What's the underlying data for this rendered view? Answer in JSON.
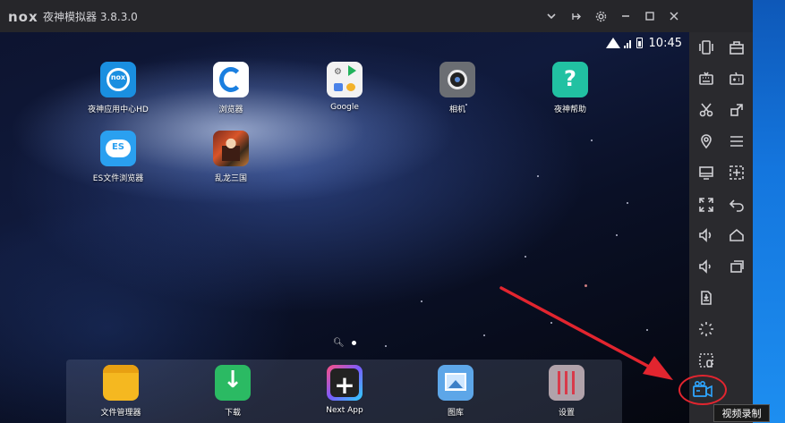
{
  "titlebar": {
    "logo": "nox",
    "app_title": "夜神模拟器 3.8.3.0",
    "buttons": [
      "chevron-down",
      "pin",
      "gear",
      "minimize",
      "maximize",
      "close"
    ]
  },
  "statusbar": {
    "time": "10:45"
  },
  "home_apps": [
    {
      "id": "nox-app-center",
      "label": "夜神应用中心HD",
      "icon": "nox-app-center-icon"
    },
    {
      "id": "browser",
      "label": "浏览器",
      "icon": "browser-icon"
    },
    {
      "id": "google",
      "label": "Google",
      "icon": "google-folder-icon"
    },
    {
      "id": "camera",
      "label": "相机",
      "icon": "camera-icon"
    },
    {
      "id": "nox-help",
      "label": "夜神帮助",
      "icon": "help-icon"
    },
    {
      "id": "es-file",
      "label": "ES文件浏览器",
      "icon": "es-file-explorer-icon"
    },
    {
      "id": "game",
      "label": "乱龙三国",
      "icon": "game-icon"
    }
  ],
  "dock_apps": [
    {
      "id": "file-manager",
      "label": "文件管理器",
      "icon": "folder-icon"
    },
    {
      "id": "download",
      "label": "下载",
      "icon": "download-icon"
    },
    {
      "id": "next-app",
      "label": "Next App",
      "icon": "next-app-icon"
    },
    {
      "id": "gallery",
      "label": "图库",
      "icon": "gallery-icon"
    },
    {
      "id": "settings",
      "label": "设置",
      "icon": "settings-icon"
    }
  ],
  "toolbar": {
    "tools": [
      "shake-icon",
      "toolbox-icon",
      "keyboard-icon",
      "gamepad-icon",
      "scissors-icon",
      "resize-icon",
      "location-icon",
      "menu-icon",
      "screen-icon",
      "add-icon",
      "fullscreen-icon",
      "back-icon",
      "volume-up-icon",
      "home-icon",
      "volume-down-icon",
      "recent-apps-icon",
      "apk-install-icon",
      "loading-icon",
      "macro-icon",
      "video-record-icon"
    ]
  },
  "tooltip": {
    "text": "视频录制"
  },
  "colors": {
    "annotation": "#e2252f",
    "titlebar": "#26262a",
    "toolbar": "#2a2a2e"
  }
}
